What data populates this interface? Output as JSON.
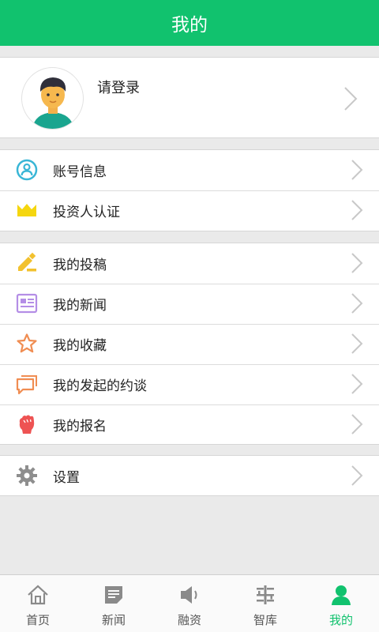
{
  "header": {
    "title": "我的"
  },
  "profile": {
    "login_text": "请登录"
  },
  "group1": [
    {
      "label": "账号信息",
      "icon": "person-circle-icon"
    },
    {
      "label": "投资人认证",
      "icon": "crown-icon"
    }
  ],
  "group2": [
    {
      "label": "我的投稿",
      "icon": "pencil-icon"
    },
    {
      "label": "我的新闻",
      "icon": "newspaper-icon"
    },
    {
      "label": "我的收藏",
      "icon": "star-icon"
    },
    {
      "label": "我的发起的约谈",
      "icon": "chat-icon"
    },
    {
      "label": "我的报名",
      "icon": "fist-icon"
    }
  ],
  "group3": [
    {
      "label": "设置",
      "icon": "gear-icon"
    }
  ],
  "tabs": [
    {
      "label": "首页",
      "icon": "home-icon"
    },
    {
      "label": "新闻",
      "icon": "news-icon"
    },
    {
      "label": "融资",
      "icon": "speaker-icon"
    },
    {
      "label": "智库",
      "icon": "grid-icon"
    },
    {
      "label": "我的",
      "icon": "user-icon",
      "active": true
    }
  ],
  "colors": {
    "brand": "#11c26e",
    "active_tab": "#11c26e"
  }
}
